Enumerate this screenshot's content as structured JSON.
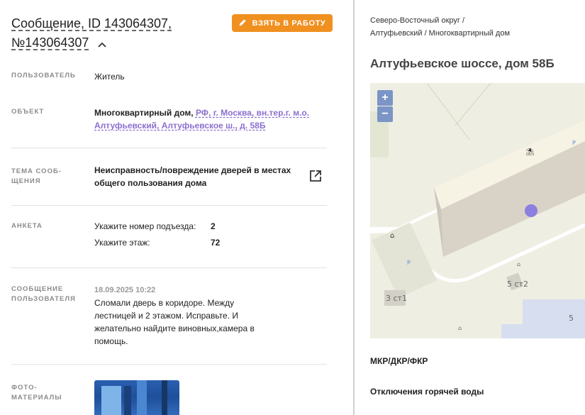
{
  "header": {
    "title_line1": "Сообщение, ID 143064307,",
    "title_line2": "№143064307",
    "take_button": "ВЗЯТЬ В РАБОТУ"
  },
  "fields": {
    "user_label": "ПОЛЬЗОВАТЕЛЬ",
    "user_value": "Житель",
    "object_label": "ОБЪЕКТ",
    "object_type": "Многоквартирный дом,",
    "object_address_line1": "РФ, г. Москва, вн.тер.г. м.о.",
    "object_address_line2": "Алтуфьевский, Алтуфьевское ш., д. 58Б",
    "topic_label_line1": "ТЕМА СООБ-",
    "topic_label_line2": "ЩЕНИЯ",
    "topic_line1": "Неисправность/повреждение дверей в местах",
    "topic_line2": "общего пользования дома",
    "survey_label": "АНКЕТА",
    "survey": [
      {
        "q": "Укажите номер подъезда:",
        "a": "2"
      },
      {
        "q": "Укажите этаж:",
        "a": "72"
      }
    ],
    "message_label_line1": "СООБЩЕНИЕ",
    "message_label_line2": "ПОЛЬЗОВАТЕЛЯ",
    "message_date": "18.09.2025 10:22",
    "message_lines": [
      "Сломали дверь в коридоре. Между",
      "лестницей и 2 этажом. Исправьте. И",
      "желательно найдите виновных,камера в",
      "помощь."
    ],
    "photo_label_line1": "ФОТО-",
    "photo_label_line2": "МАТЕРИАЛЫ"
  },
  "right": {
    "breadcrumb_line1": "Северо-Восточный округ /",
    "breadcrumb_line2": "Алтуфьевский / Многоквартирный дом",
    "address": "Алтуфьевское шоссе, дом 58Б",
    "zoom_in": "+",
    "zoom_out": "−",
    "map_labels": [
      "5 ст2",
      "3 ст1",
      "5",
      "P",
      "P"
    ],
    "item1": "МКР/ДКР/ФКР",
    "item2": "Отключения горячей воды"
  },
  "colors": {
    "accent_orange": "#f0901f",
    "link_purple": "#8c6fcf",
    "marker": "#8c7fe0"
  }
}
